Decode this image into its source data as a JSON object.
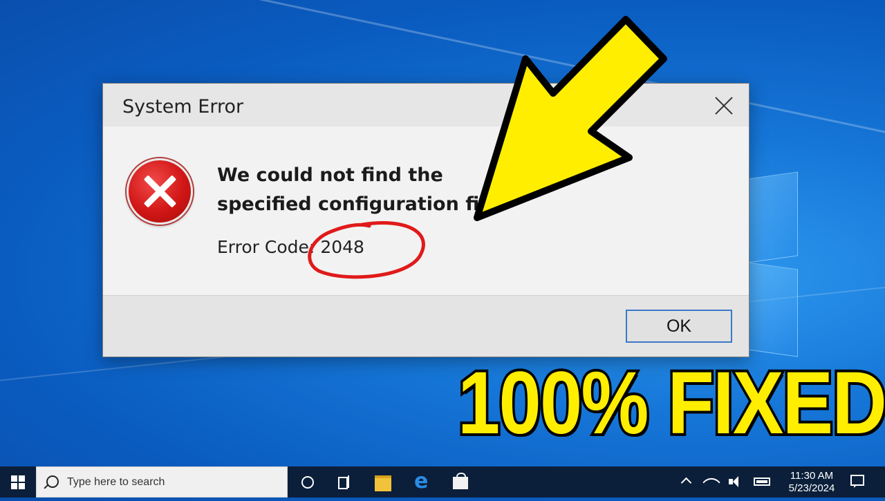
{
  "dialog": {
    "title": "System Error",
    "message": "We could not find the specified configuration file.",
    "error_code_label": "Error Code:",
    "error_code_value": "2048",
    "ok_label": "OK",
    "icon": "error-icon"
  },
  "overlay": {
    "banner_text": "100% FIXED",
    "banner_color": "#ffee00",
    "arrow_color": "#ffee00",
    "circle_color": "#e01a1a"
  },
  "taskbar": {
    "search_placeholder": "Type here to search",
    "time": "11:30 AM",
    "date": "5/23/2024"
  }
}
